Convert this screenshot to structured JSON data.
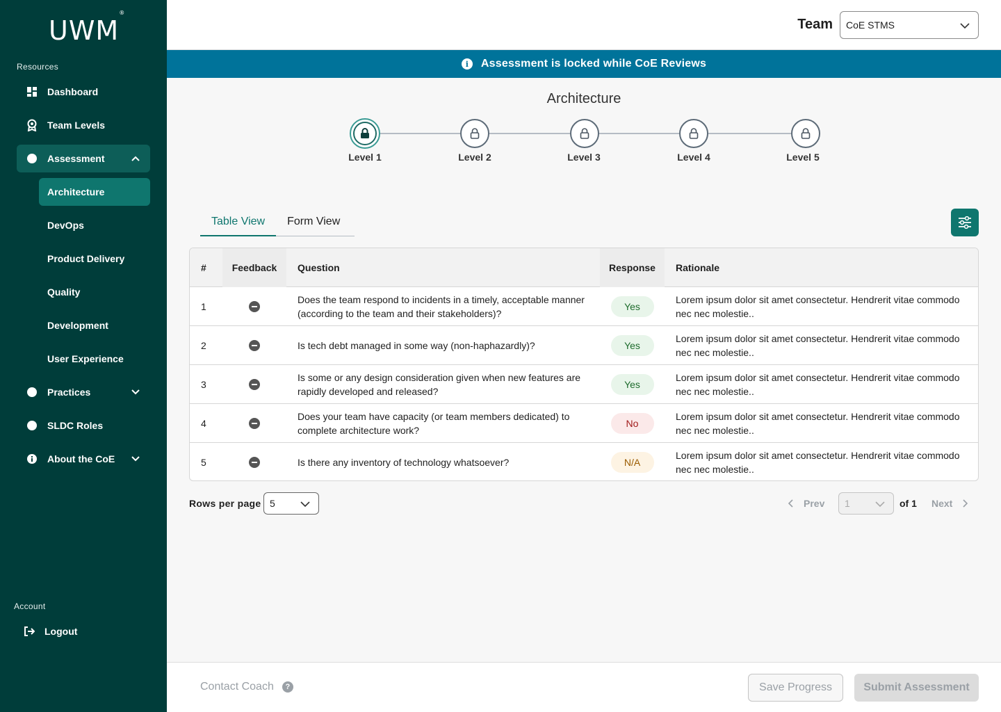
{
  "sidebar": {
    "logo": "UWM",
    "resources_label": "Resources",
    "items": [
      {
        "label": "Dashboard"
      },
      {
        "label": "Team Levels"
      },
      {
        "label": "Assessment"
      },
      {
        "label": "Practices"
      },
      {
        "label": "SLDC Roles"
      },
      {
        "label": "About the CoE"
      }
    ],
    "assessment_sub": [
      "Architecture",
      "DevOps",
      "Product Delivery",
      "Quality",
      "Development",
      "User Experience"
    ],
    "account_label": "Account",
    "logout_label": "Logout"
  },
  "header": {
    "team_label": "Team",
    "team_value": "CoE STMS"
  },
  "banner": {
    "text": "Assessment is locked while CoE Reviews"
  },
  "main": {
    "title": "Architecture",
    "levels": [
      "Level 1",
      "Level 2",
      "Level 3",
      "Level 4",
      "Level 5"
    ],
    "current_level": 1,
    "tabs": [
      {
        "label": "Table View",
        "active": true
      },
      {
        "label": "Form View",
        "active": false
      }
    ]
  },
  "table": {
    "headers": [
      "#",
      "Feedback",
      "Question",
      "Response",
      "Rationale"
    ],
    "rows": [
      {
        "num": "1",
        "question": "Does the team respond to incidents in a timely, acceptable manner (according to the team and their stakeholders)?",
        "response": "Yes",
        "rationale": "Lorem ipsum dolor sit amet consectetur. Hendrerit vitae commodo nec nec molestie.."
      },
      {
        "num": "2",
        "question": "Is tech debt managed in some way (non-haphazardly)?",
        "response": "Yes",
        "rationale": "Lorem ipsum dolor sit amet consectetur. Hendrerit vitae commodo nec nec molestie.."
      },
      {
        "num": "3",
        "question": "Is some or any design consideration given when new features are rapidly developed and released?",
        "response": "Yes",
        "rationale": "Lorem ipsum dolor sit amet consectetur. Hendrerit vitae commodo nec nec molestie.."
      },
      {
        "num": "4",
        "question": "Does your team have capacity (or team members dedicated) to complete architecture work?",
        "response": "No",
        "rationale": "Lorem ipsum dolor sit amet consectetur. Hendrerit vitae commodo nec nec molestie.."
      },
      {
        "num": "5",
        "question": "Is there any inventory of technology whatsoever?",
        "response": "N/A",
        "rationale": "Lorem ipsum dolor sit amet consectetur. Hendrerit vitae commodo nec nec molestie.."
      }
    ]
  },
  "pagination": {
    "rows_per_page_label": "Rows per page",
    "rows_per_page": "5",
    "prev_label": "Prev",
    "page": "1",
    "of_label": "of 1",
    "next_label": "Next"
  },
  "footer": {
    "contact_label": "Contact Coach",
    "save_label": "Save Progress",
    "submit_label": "Submit Assessment"
  },
  "colors": {
    "sidebar_bg": "#003d3a",
    "accent": "#0f766e",
    "banner_bg": "#00739a"
  }
}
